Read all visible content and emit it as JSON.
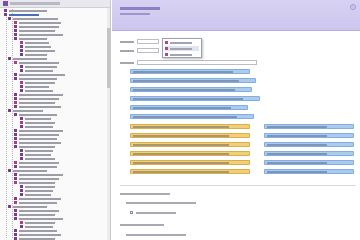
{
  "tree": {
    "title": "",
    "items": [
      {
        "label": ""
      },
      {
        "label": ""
      },
      {
        "label": ""
      },
      {
        "label": ""
      },
      {
        "label": ""
      },
      {
        "label": ""
      },
      {
        "label": ""
      },
      {
        "label": ""
      },
      {
        "label": ""
      },
      {
        "label": ""
      },
      {
        "label": ""
      },
      {
        "label": ""
      },
      {
        "label": ""
      },
      {
        "label": ""
      },
      {
        "label": ""
      },
      {
        "label": ""
      },
      {
        "label": ""
      },
      {
        "label": ""
      },
      {
        "label": ""
      },
      {
        "label": ""
      },
      {
        "label": ""
      },
      {
        "label": ""
      },
      {
        "label": ""
      },
      {
        "label": ""
      },
      {
        "label": ""
      },
      {
        "label": ""
      },
      {
        "label": ""
      },
      {
        "label": ""
      },
      {
        "label": ""
      },
      {
        "label": ""
      },
      {
        "label": ""
      },
      {
        "label": ""
      },
      {
        "label": ""
      },
      {
        "label": ""
      },
      {
        "label": ""
      },
      {
        "label": ""
      },
      {
        "label": ""
      },
      {
        "label": ""
      },
      {
        "label": ""
      },
      {
        "label": ""
      },
      {
        "label": ""
      },
      {
        "label": ""
      },
      {
        "label": ""
      },
      {
        "label": ""
      },
      {
        "label": ""
      },
      {
        "label": ""
      },
      {
        "label": ""
      },
      {
        "label": ""
      },
      {
        "label": ""
      },
      {
        "label": ""
      },
      {
        "label": ""
      },
      {
        "label": ""
      },
      {
        "label": ""
      },
      {
        "label": ""
      },
      {
        "label": ""
      },
      {
        "label": ""
      },
      {
        "label": ""
      },
      {
        "label": ""
      }
    ]
  },
  "header": {
    "title": "",
    "subtitle": ""
  },
  "form": {
    "rows": [
      {
        "label": ""
      },
      {
        "label": ""
      },
      {
        "label": ""
      }
    ],
    "dropdown_options": [
      {
        "label": ""
      },
      {
        "label": ""
      },
      {
        "label": ""
      }
    ]
  },
  "blocks": {
    "blue_rows": [
      {
        "text": ""
      },
      {
        "text": ""
      },
      {
        "text": ""
      },
      {
        "text": ""
      },
      {
        "text": ""
      },
      {
        "text": ""
      }
    ],
    "gold_rows": [
      {
        "left": "",
        "right": ""
      },
      {
        "left": "",
        "right": ""
      },
      {
        "left": "",
        "right": ""
      },
      {
        "left": "",
        "right": ""
      },
      {
        "left": "",
        "right": ""
      },
      {
        "left": "",
        "right": ""
      }
    ]
  },
  "details": [
    {
      "label": ""
    },
    {
      "label": ""
    },
    {
      "label": ""
    },
    {
      "label": ""
    },
    {
      "label": ""
    }
  ],
  "colors": {
    "header_purple": "#cdc6ee",
    "tree_icon": "#7a3d8c",
    "chip_blue": "#a9cbee",
    "chip_gold": "#f2cf74"
  }
}
